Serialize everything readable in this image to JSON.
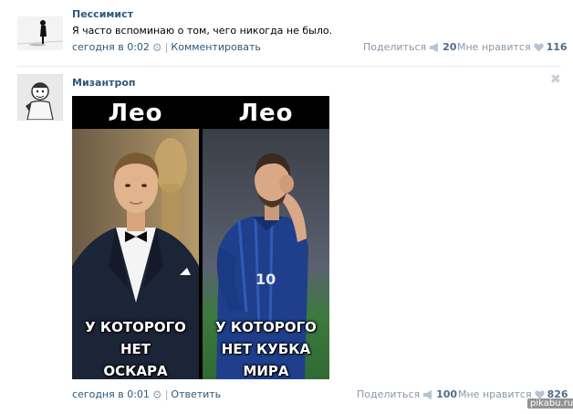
{
  "post1": {
    "author": "Пессимист",
    "text": "Я часто вспоминаю о том, чего никогда не было.",
    "time": "сегодня в 0:02",
    "comment_label": "Комментировать",
    "share_label": "Поделиться",
    "share_count": "20",
    "like_label": "Мне нравится",
    "like_count": "116"
  },
  "post2": {
    "author": "Мизантроп",
    "time": "сегодня в 0:01",
    "reply_label": "Ответить",
    "share_label": "Поделиться",
    "share_count": "100",
    "like_label": "Мне нравится",
    "like_count": "826",
    "close_glyph": "✖",
    "meme": {
      "left_title": "Лео",
      "left_caption_1": "У КОТОРОГО",
      "left_caption_2": "НЕТ",
      "left_caption_3": "ОСКАРА",
      "right_title": "Лео",
      "right_caption_1": "У КОТОРОГО",
      "right_caption_2": "НЕТ КУБКА",
      "right_caption_3": "МИРА"
    }
  },
  "watermark": "pikabu.ru",
  "colors": {
    "link": "#2b587a",
    "muted": "#777777",
    "counter": "#4e6c8c",
    "divider": "#e7eaed"
  },
  "icons": {
    "settings": "gear-icon",
    "share": "megaphone-icon",
    "like": "heart-icon",
    "close": "close-icon"
  }
}
